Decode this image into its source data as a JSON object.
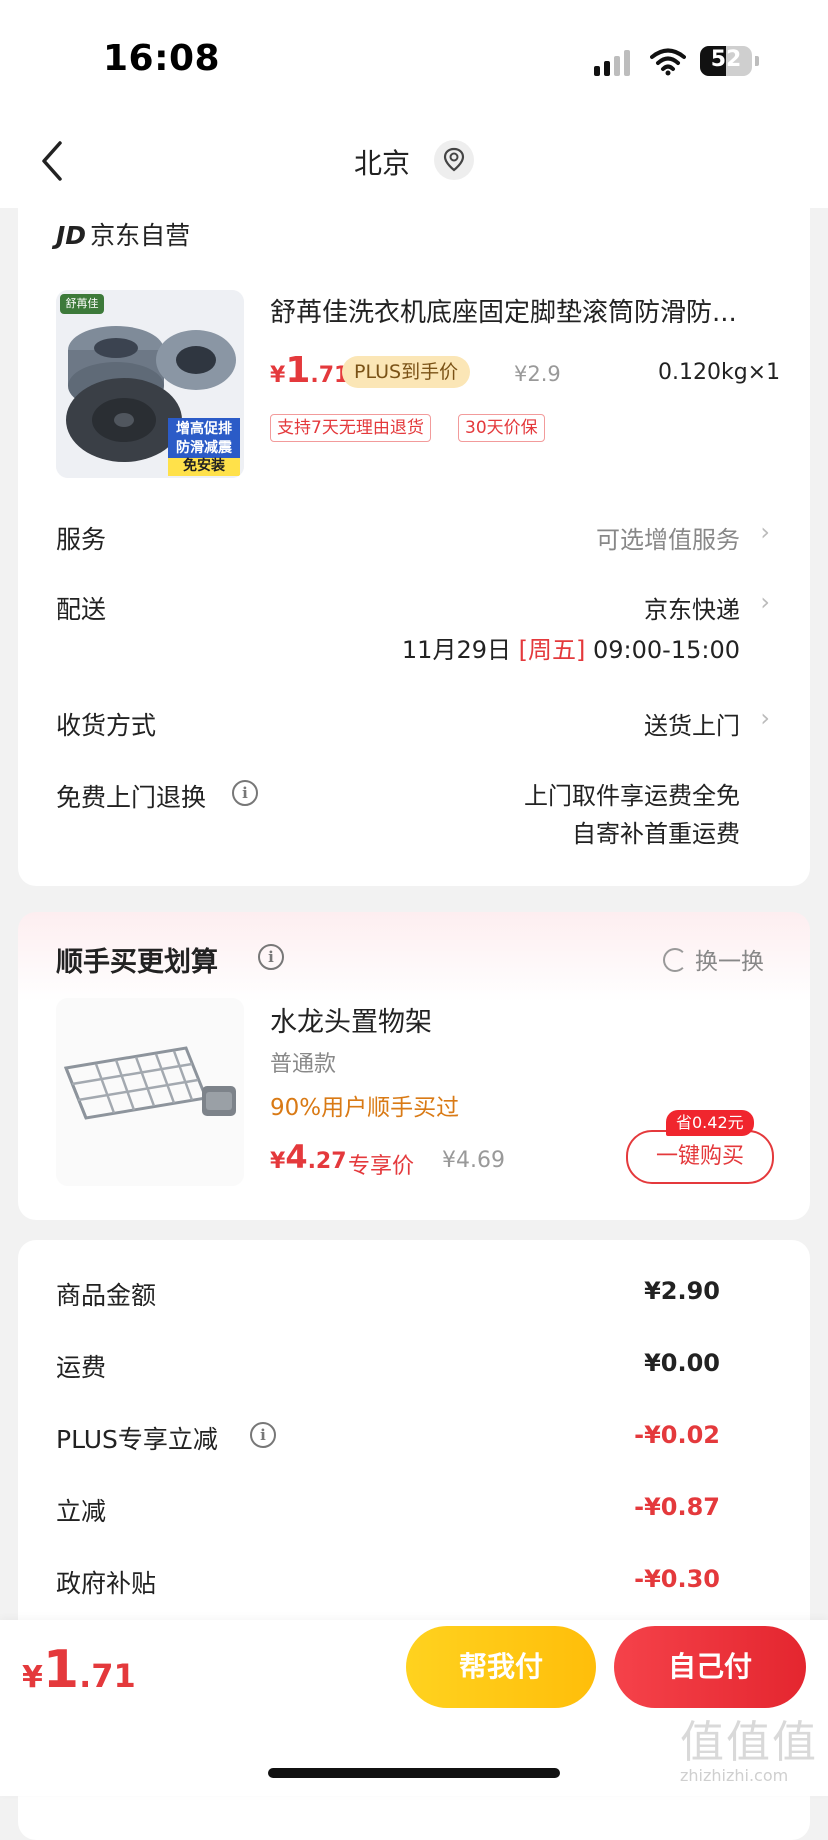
{
  "status": {
    "time": "16:08",
    "battery": "52"
  },
  "nav": {
    "title": "北京",
    "back_icon": "chevron-left-icon",
    "location_icon": "location-pin-icon"
  },
  "shop": {
    "logo": "JD",
    "name": "京东自营"
  },
  "product": {
    "title": "舒苒佳洗衣机底座固定脚垫滚筒防滑防...",
    "image_brand": "舒苒佳",
    "image_caption": [
      "增高促排",
      "防滑减震",
      "免安装"
    ],
    "price_currency": "¥",
    "price_int": "1",
    "price_dec": ".71",
    "plus_tag": "PLUS到手价",
    "orig_price": "¥2.9",
    "weight": "0.120kg×1",
    "tags": [
      "支持7天无理由退货",
      "30天价保"
    ]
  },
  "rows": {
    "service_label": "服务",
    "service_value": "可选增值服务",
    "delivery_label": "配送",
    "delivery_value": "京东快递",
    "delivery_date": "11月29日",
    "delivery_day": "[周五]",
    "delivery_time": "09:00-15:00",
    "receive_label": "收货方式",
    "receive_value": "送货上门",
    "return_label": "免费上门退换",
    "return_line1": "上门取件享运费全免",
    "return_line2": "自寄补首重运费"
  },
  "upsell": {
    "title": "顺手买更划算",
    "swap_label": "换一换",
    "name": "水龙头置物架",
    "spec": "普通款",
    "bought": "90%用户顺手买过",
    "price_currency": "¥",
    "price_int": "4",
    "price_dec": ".27",
    "exclusive": "专享价",
    "orig_price": "¥4.69",
    "save_badge": "省0.42元",
    "buy_label": "一键购买"
  },
  "summary": [
    {
      "label": "商品金额",
      "value": "¥2.90"
    },
    {
      "label": "运费",
      "value": "¥0.00"
    },
    {
      "label": "PLUS专享立减",
      "value": "-¥0.02"
    },
    {
      "label": "立减",
      "value": "-¥0.87"
    },
    {
      "label": "政府补贴",
      "value": "-¥0.30"
    }
  ],
  "bottom": {
    "total_currency": "¥",
    "total_int": "1",
    "total_dec": ".71",
    "help_pay": "帮我付",
    "self_pay": "自己付",
    "watermark": "值值值",
    "watermark_url": "zhizhizhi.com"
  },
  "colors": {
    "accent_red": "#e4393c",
    "plus_gold": "#fbe6b6",
    "help_yellow": "#ffc612"
  }
}
